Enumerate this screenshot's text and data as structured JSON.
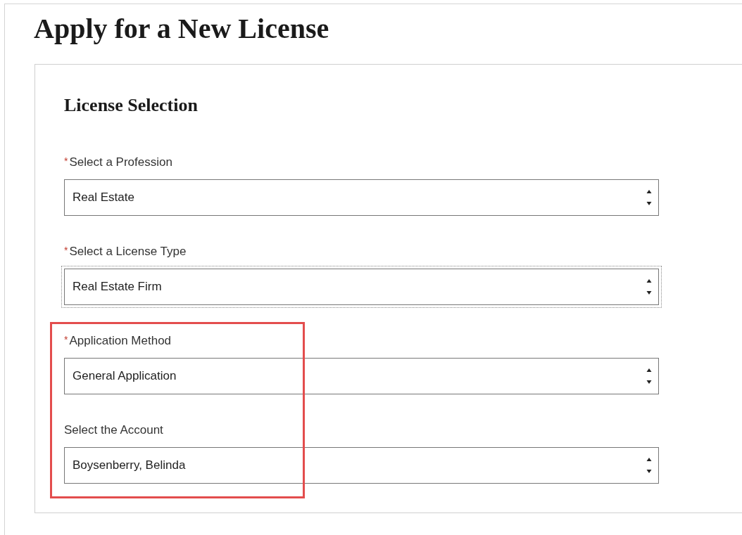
{
  "page": {
    "title": "Apply for a New License"
  },
  "section": {
    "heading": "License Selection"
  },
  "required_marker": "*",
  "fields": [
    {
      "label": "Select a Profession",
      "value": "Real Estate",
      "required": true,
      "focused": false,
      "highlighted": false
    },
    {
      "label": "Select a License Type",
      "value": "Real Estate Firm",
      "required": true,
      "focused": true,
      "highlighted": false
    },
    {
      "label": "Application Method",
      "value": "General Application",
      "required": true,
      "focused": false,
      "highlighted": true
    },
    {
      "label": "Select the Account",
      "value": "Boysenberry, Belinda",
      "required": false,
      "focused": false,
      "highlighted": true
    }
  ]
}
